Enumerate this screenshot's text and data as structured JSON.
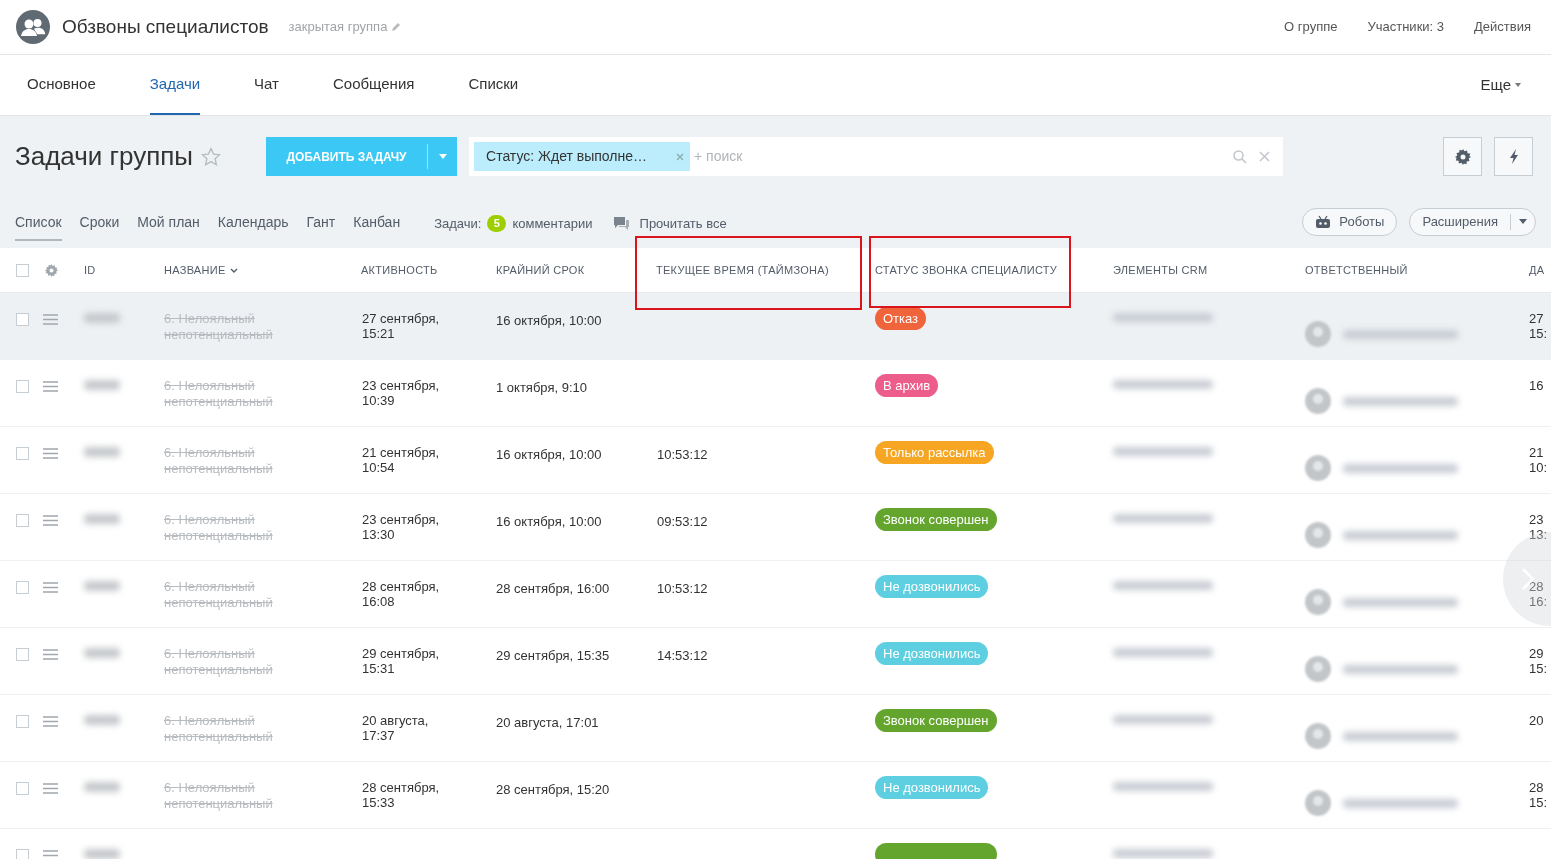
{
  "header": {
    "title": "Обзвоны специалистов",
    "subtitle": "закрытая группа",
    "links": [
      "О группе",
      "Участники: 3",
      "Действия"
    ]
  },
  "tabs": [
    {
      "label": "Основное",
      "selected": false
    },
    {
      "label": "Задачи",
      "selected": true
    },
    {
      "label": "Чат",
      "selected": false
    },
    {
      "label": "Сообщения",
      "selected": false
    },
    {
      "label": "Списки",
      "selected": false
    }
  ],
  "more_tab": "Еще",
  "toolbar": {
    "title": "Задачи группы",
    "add_button": "ДОБАВИТЬ ЗАДАЧУ",
    "filter_chip": "Статус: Ждет выполне…",
    "search_placeholder": "+ поиск"
  },
  "views": [
    {
      "label": "Список",
      "selected": true
    },
    {
      "label": "Сроки",
      "selected": false
    },
    {
      "label": "Мой план",
      "selected": false
    },
    {
      "label": "Календарь",
      "selected": false
    },
    {
      "label": "Гант",
      "selected": false
    },
    {
      "label": "Канбан",
      "selected": false
    }
  ],
  "counters": {
    "label": "Задачи:",
    "count": "5",
    "count_label": "комментарии",
    "read_all": "Прочитать все"
  },
  "right_buttons": {
    "robots": "Роботы",
    "extensions": "Расширения"
  },
  "table": {
    "columns": [
      "ID",
      "НАЗВАНИЕ",
      "АКТИВНОСТЬ",
      "КРАЙНИЙ СРОК",
      "ТЕКУЩЕЕ ВРЕМЯ (ТАЙМЗОНА)",
      "СТАТУС ЗВОНКА СПЕЦИАЛИСТУ",
      "ЭЛЕМЕНТЫ CRM",
      "ОТВЕТСТВЕННЫЙ",
      "ДА"
    ],
    "all_checked": false,
    "rows": [
      {
        "checked": false,
        "selected": true,
        "completed": true,
        "title": "6. Нелояльный непотенциальный",
        "activity": [
          "27 сентября,",
          "15:21"
        ],
        "deadline": "16 октября, 10:00",
        "status": "Отказ",
        "color": "#f0643c",
        "date": [
          "27",
          "15:"
        ]
      },
      {
        "checked": false,
        "selected": false,
        "completed": true,
        "title": "6. Нелояльный непотенциальный",
        "activity": [
          "23 сентября,",
          "10:39"
        ],
        "deadline": "1 октября, 9:10",
        "status": "В архив",
        "color": "#ec5d8c",
        "date": [
          "16"
        ]
      },
      {
        "checked": false,
        "selected": false,
        "completed": true,
        "title": "6. Нелояльный непотенциальный",
        "activity": [
          "21 сентября,",
          "10:54"
        ],
        "deadline": "16 октября, 10:00",
        "time": "10:53:12",
        "status": "Только рассылка",
        "color": "#f7a623",
        "date": [
          "21",
          "10:"
        ]
      },
      {
        "checked": false,
        "selected": false,
        "completed": true,
        "title": "6. Нелояльный непотенциальный",
        "activity": [
          "23 сентября,",
          "13:30"
        ],
        "deadline": "16 октября, 10:00",
        "time": "09:53:12",
        "status": "Звонок совершен",
        "color": "#63a52d",
        "date": [
          "23",
          "13:"
        ]
      },
      {
        "checked": false,
        "selected": false,
        "completed": true,
        "title": "6. Нелояльный непотенциальный",
        "activity": [
          "28 сентября,",
          "16:08"
        ],
        "deadline": "28 сентября, 16:00",
        "time": "10:53:12",
        "status": "Не дозвонились",
        "color": "#5ecfe0",
        "date": [
          "28",
          "16:"
        ]
      },
      {
        "checked": false,
        "selected": false,
        "completed": true,
        "title": "6. Нелояльный непотенциальный",
        "activity": [
          "29 сентября,",
          "15:31"
        ],
        "deadline": "29 сентября, 15:35",
        "time": "14:53:12",
        "status": "Не дозвонились",
        "color": "#5ecfe0",
        "date": [
          "29",
          "15:"
        ]
      },
      {
        "checked": false,
        "selected": false,
        "completed": true,
        "title": "6. Нелояльный непотенциальный",
        "activity": [
          "20 августа,",
          "17:37"
        ],
        "deadline": "20 августа, 17:01",
        "status": "Звонок совершен",
        "color": "#63a52d",
        "date": [
          "20"
        ]
      },
      {
        "checked": false,
        "selected": false,
        "completed": true,
        "title": "6. Нелояльный непотенциальный",
        "activity": [
          "28 сентября,",
          "15:33"
        ],
        "deadline": "28 сентября, 15:20",
        "status": "Не дозвонились",
        "color": "#5ecfe0",
        "date": [
          "28",
          "15:"
        ]
      },
      {
        "checked": false,
        "selected": false,
        "color": "#63a52d"
      }
    ]
  }
}
